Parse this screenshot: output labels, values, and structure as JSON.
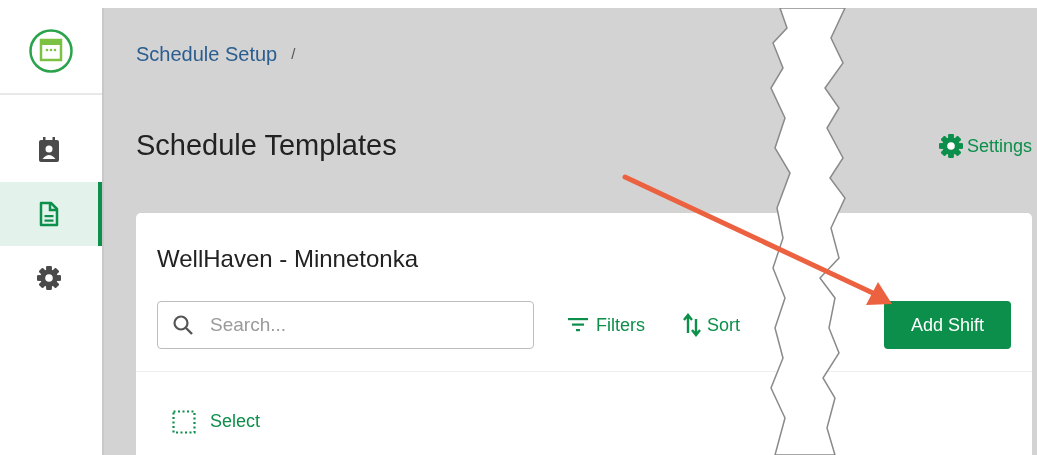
{
  "breadcrumb": [
    "Schedule Setup"
  ],
  "breadcrumb_separator": "/",
  "sidebar": {
    "items": [
      {
        "kind": "calendar-person",
        "selected": false
      },
      {
        "kind": "document",
        "selected": true
      },
      {
        "kind": "gear",
        "selected": false
      }
    ]
  },
  "page_title": "Schedule Templates",
  "settings_link": "Settings",
  "card": {
    "title": "WellHaven - Minnetonka",
    "search": {
      "placeholder": "Search..."
    },
    "filters": "Filters",
    "sort": "Sort",
    "add_button": "Add Shift",
    "select": "Select"
  }
}
